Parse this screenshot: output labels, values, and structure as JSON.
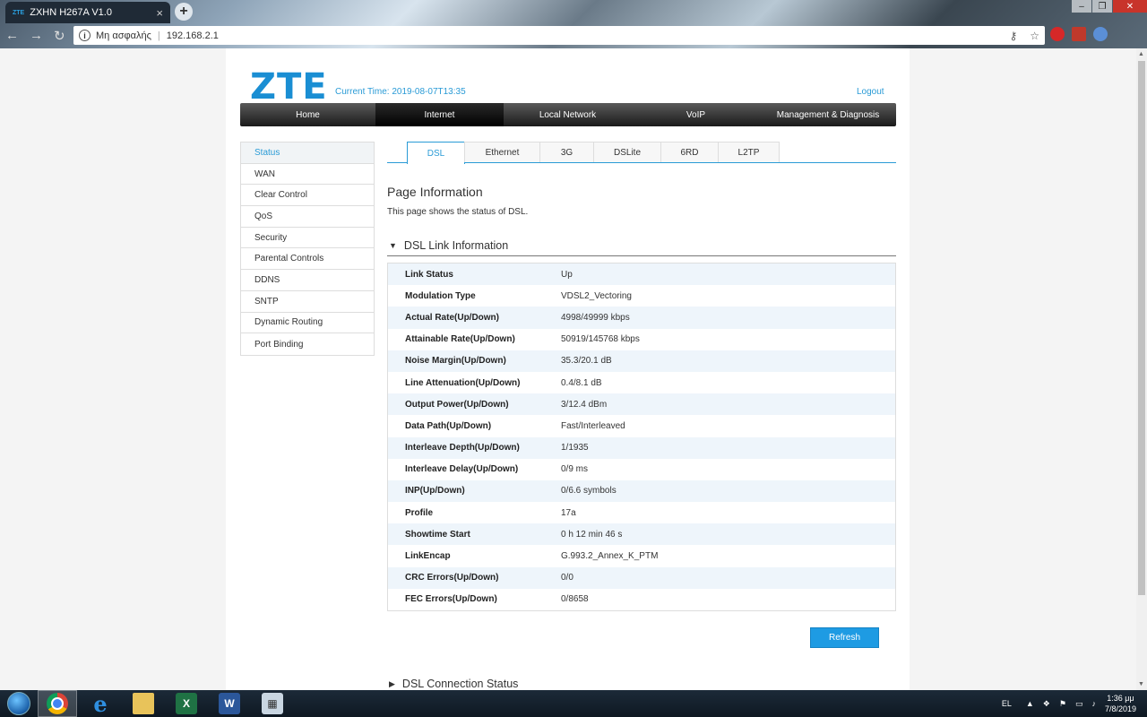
{
  "browser": {
    "tab_title": "ZXHN H267A V1.0",
    "tab_favicon": "ZTE",
    "new_tab": "+",
    "security_label": "Μη ασφαλής",
    "url": "192.168.2.1"
  },
  "header": {
    "logo": "ZTE",
    "current_time": "Current Time: 2019-08-07T13:35",
    "logout": "Logout"
  },
  "main_nav": [
    {
      "label": "Home",
      "active": false
    },
    {
      "label": "Internet",
      "active": true
    },
    {
      "label": "Local Network",
      "active": false
    },
    {
      "label": "VoIP",
      "active": false
    },
    {
      "label": "Management & Diagnosis",
      "active": false
    }
  ],
  "side_menu": [
    {
      "label": "Status",
      "active": true
    },
    {
      "label": "WAN",
      "active": false
    },
    {
      "label": "Clear Control",
      "active": false
    },
    {
      "label": "QoS",
      "active": false
    },
    {
      "label": "Security",
      "active": false
    },
    {
      "label": "Parental Controls",
      "active": false
    },
    {
      "label": "DDNS",
      "active": false
    },
    {
      "label": "SNTP",
      "active": false
    },
    {
      "label": "Dynamic Routing",
      "active": false
    },
    {
      "label": "Port Binding",
      "active": false
    }
  ],
  "sub_tabs": [
    {
      "label": "DSL",
      "active": true
    },
    {
      "label": "Ethernet",
      "active": false
    },
    {
      "label": "3G",
      "active": false
    },
    {
      "label": "DSLite",
      "active": false
    },
    {
      "label": "6RD",
      "active": false
    },
    {
      "label": "L2TP",
      "active": false
    }
  ],
  "page_info": {
    "title": "Page Information",
    "description": "This page shows the status of DSL."
  },
  "dsl_link": {
    "title": "DSL Link Information",
    "rows": [
      {
        "key": "Link Status",
        "value": "Up"
      },
      {
        "key": "Modulation Type",
        "value": "VDSL2_Vectoring"
      },
      {
        "key": "Actual Rate(Up/Down)",
        "value": "4998/49999 kbps"
      },
      {
        "key": "Attainable Rate(Up/Down)",
        "value": "50919/145768 kbps"
      },
      {
        "key": "Noise Margin(Up/Down)",
        "value": "35.3/20.1 dB"
      },
      {
        "key": "Line Attenuation(Up/Down)",
        "value": "0.4/8.1 dB"
      },
      {
        "key": "Output Power(Up/Down)",
        "value": "3/12.4 dBm"
      },
      {
        "key": "Data Path(Up/Down)",
        "value": "Fast/Interleaved"
      },
      {
        "key": "Interleave Depth(Up/Down)",
        "value": "1/1935"
      },
      {
        "key": "Interleave Delay(Up/Down)",
        "value": "0/9 ms"
      },
      {
        "key": "INP(Up/Down)",
        "value": "0/6.6 symbols"
      },
      {
        "key": "Profile",
        "value": "17a"
      },
      {
        "key": "Showtime Start",
        "value": "0 h 12 min 46 s"
      },
      {
        "key": "LinkEncap",
        "value": "G.993.2_Annex_K_PTM"
      },
      {
        "key": "CRC Errors(Up/Down)",
        "value": "0/0"
      },
      {
        "key": "FEC Errors(Up/Down)",
        "value": "0/8658"
      }
    ]
  },
  "refresh_label": "Refresh",
  "dsl_connection": {
    "title": "DSL Connection Status"
  },
  "taskbar": {
    "lang": "EL",
    "time": "1:36 μμ",
    "date": "7/8/2019"
  }
}
